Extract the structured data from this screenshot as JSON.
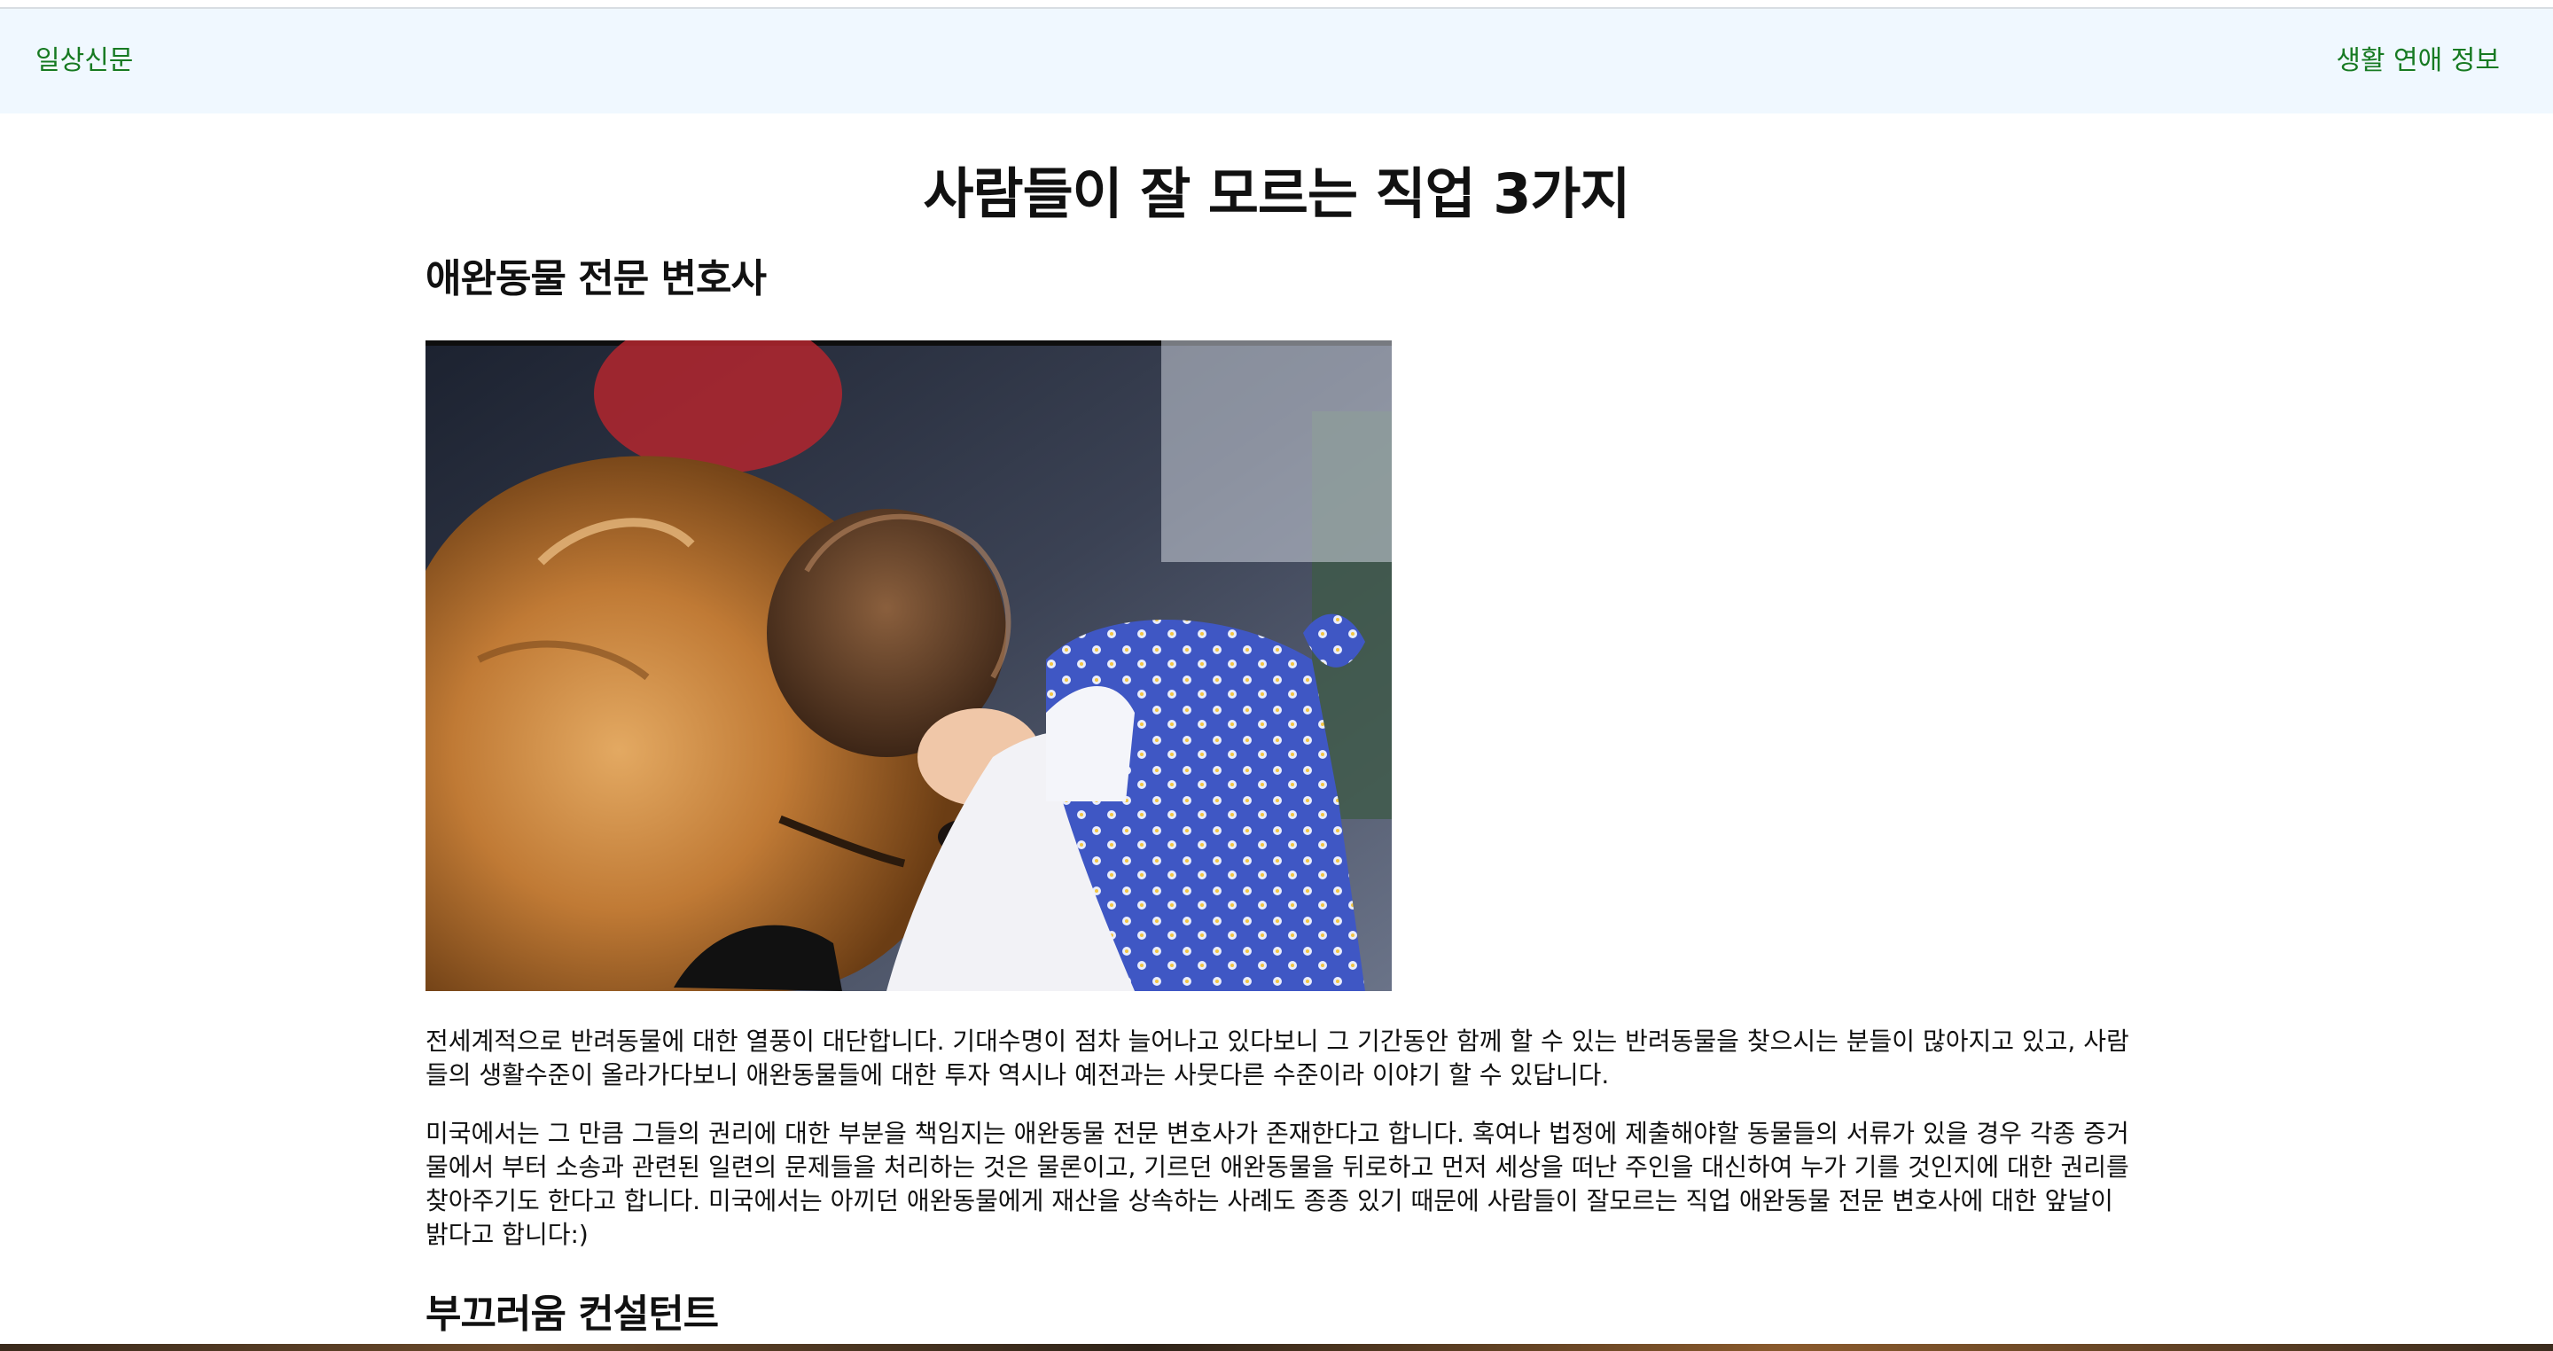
{
  "navbar": {
    "brand": "일상신문",
    "menu": "생활 연애 정보"
  },
  "page": {
    "title": "사람들이 잘 모르는 직업 3가지"
  },
  "sections": [
    {
      "heading": "애완동물 전문 변호사",
      "image_alt": "golden retriever and toddler in blue floral dress touching heads",
      "paragraphs": [
        "전세계적으로 반려동물에 대한 열풍이 대단합니다. 기대수명이 점차 늘어나고 있다보니 그 기간동안 함께 할 수 있는 반려동물을 찾으시는 분들이 많아지고 있고, 사람들의 생활수준이 올라가다보니 애완동물들에 대한 투자 역시나 예전과는 사뭇다른 수준이라 이야기 할 수 있답니다.",
        "미국에서는 그 만큼 그들의 권리에 대한 부분을 책임지는 애완동물 전문 변호사가 존재한다고 합니다. 혹여나 법정에 제출해야할 동물들의 서류가 있을 경우 각종 증거물에서 부터 소송과 관련된 일련의 문제들을 처리하는 것은 물론이고, 기르던 애완동물을 뒤로하고 먼저 세상을 떠난 주인을 대신하여 누가 기를 것인지에 대한 권리를 찾아주기도 한다고 합니다. 미국에서는 아끼던 애완동물에게 재산을 상속하는 사례도 종종 있기 때문에 사람들이 잘모르는 직업 애완동물 전문 변호사에 대한 앞날이 밝다고 합니다:)"
      ]
    },
    {
      "heading": "부끄러움 컨설턴트"
    }
  ],
  "colors": {
    "nav_bg": "#f0f8ff",
    "nav_link": "#177a22",
    "text": "#111111"
  }
}
